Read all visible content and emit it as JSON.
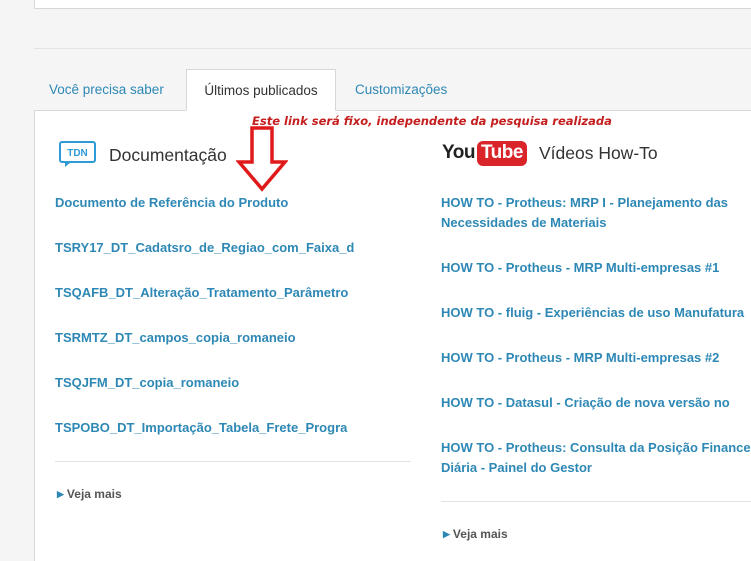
{
  "tabs": [
    {
      "label": "Você precisa saber",
      "active": false
    },
    {
      "label": "Últimos publicados",
      "active": true
    },
    {
      "label": "Customizações",
      "active": false
    }
  ],
  "documentacao": {
    "icon": "tdn-logo-icon",
    "icon_text": "TDN",
    "title": "Documentação",
    "links": [
      "Documento de Referência do Produto",
      "TSRY17_DT_Cadatsro_de_Regiao_com_Faixa_d",
      "TSQAFB_DT_Alteração_Tratamento_Parâmetro",
      "TSRMTZ_DT_campos_copia_romaneio",
      "TSQJFM_DT_copia_romaneio",
      "TSPOBO_DT_Importação_Tabela_Frete_Progra"
    ],
    "more_label": "Veja mais"
  },
  "videos": {
    "logo": {
      "you": "You",
      "tube": "Tube"
    },
    "title": "Vídeos How-To",
    "links": [
      "HOW TO - Protheus: MRP I - Planejamento das Necessidades de Materiais",
      "HOW TO - Protheus - MRP Multi-empresas #1",
      "HOW TO - fluig - Experiências de uso Manufatura",
      "HOW TO - Protheus - MRP Multi-empresas #2",
      "HOW TO - Datasul - Criação de nova versão no",
      "HOW TO - Protheus: Consulta da Posição Financeira Diária - Painel do Gestor"
    ],
    "more_label": "Veja mais"
  },
  "annotation": {
    "text": "Este link será fixo, independente da pesquisa realizada",
    "color": "#c41e1e"
  },
  "colors": {
    "link": "#2e88b5",
    "youtube_red": "#d9242a",
    "tdn_blue": "#2e9bd6"
  }
}
